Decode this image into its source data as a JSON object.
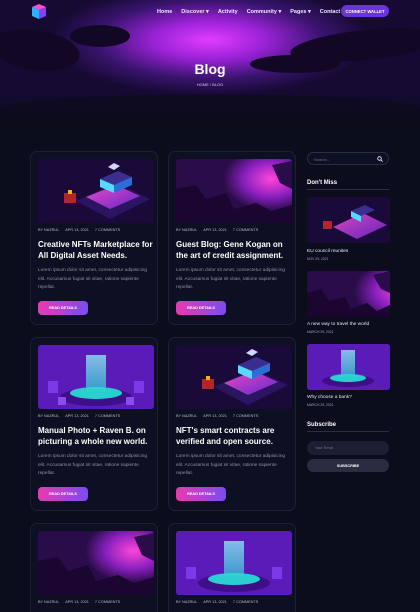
{
  "nav": {
    "items": [
      "Home",
      "Discover ▾",
      "Activity",
      "Community ▾",
      "Pages ▾",
      "Contact"
    ],
    "connect_label": "CONNECT WALLET"
  },
  "hero": {
    "title": "Blog",
    "breadcrumb": "HOME  /  BLOG"
  },
  "posts": [
    {
      "author": "BY NAZRUL",
      "date": "APR 13, 2021",
      "comments": "7 COMMENTS",
      "title": "Creative NFTs Marketplace for All Digital Asset Needs.",
      "excerpt": "Lorem ipsum dolor sit amet, consectetur adipisicing elit. Accusamus fugiat sit vitae, ratione sapiente repellat.",
      "button": "READ DETAILS"
    },
    {
      "author": "BY NAZRUL",
      "date": "APR 13, 2021",
      "comments": "7 COMMENTS",
      "title": "Guest Blog: Gene Kogan on the art of credit assignment.",
      "excerpt": "Lorem ipsum dolor sit amet, consectetur adipisicing elit. Accusamus fugiat sit vitae, ratione sapiente repellat.",
      "button": "READ DETAILS"
    },
    {
      "author": "BY NAZRUL",
      "date": "APR 13, 2021",
      "comments": "7 COMMENTS",
      "title": "Manual Photo + Raven B. on picturing a whole new world.",
      "excerpt": "Lorem ipsum dolor sit amet, consectetur adipisicing elit. Accusamus fugiat sit vitae, ratione sapiente repellat.",
      "button": "READ DETAILS"
    },
    {
      "author": "BY NAZRUL",
      "date": "APR 13, 2021",
      "comments": "7 COMMENTS",
      "title": "NFT's smart contracts are verified and open source.",
      "excerpt": "Lorem ipsum dolor sit amet, consectetur adipisicing elit. Accusamus fugiat sit vitae, ratione sapiente repellat.",
      "button": "READ DETAILS"
    },
    {
      "author": "BY NAZRUL",
      "date": "APR 13, 2021",
      "comments": "7 COMMENTS"
    },
    {
      "author": "BY NAZRUL",
      "date": "APR 13, 2021",
      "comments": "7 COMMENTS"
    }
  ],
  "sidebar": {
    "search_placeholder": "Search...",
    "dont_miss": "Don't Miss",
    "items": [
      {
        "title": "EU council reunites",
        "date": "NOV 29, 2021"
      },
      {
        "title": "A new way to travel the world",
        "date": "MARCH 29, 2021"
      },
      {
        "title": "Why choose a bank?",
        "date": "MARCH 29, 2021"
      }
    ],
    "subscribe_heading": "Subscribe",
    "email_placeholder": "Your Email",
    "subscribe_label": "SUBSCRIBE"
  },
  "colors": {
    "accent": "#6b33e0",
    "button_start": "#e73bb0",
    "button_end": "#7a4cf0",
    "background": "#0b0c1c"
  }
}
